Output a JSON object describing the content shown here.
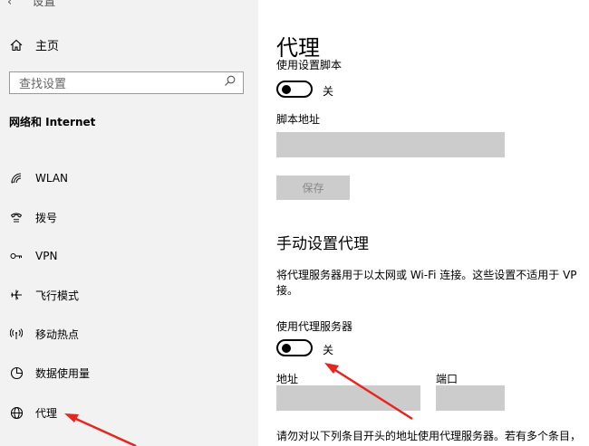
{
  "window": {
    "back_glyph": "‹",
    "title_partial": "设置"
  },
  "sidebar": {
    "home_label": "主页",
    "search_placeholder": "查找设置",
    "section_title": "网络和 Internet",
    "items": [
      {
        "label": "WLAN",
        "icon": "wifi-icon"
      },
      {
        "label": "拨号",
        "icon": "dialup-icon"
      },
      {
        "label": "VPN",
        "icon": "vpn-icon"
      },
      {
        "label": "飞行模式",
        "icon": "airplane-icon"
      },
      {
        "label": "移动热点",
        "icon": "hotspot-icon"
      },
      {
        "label": "数据使用量",
        "icon": "data-usage-icon"
      },
      {
        "label": "代理",
        "icon": "globe-icon"
      }
    ]
  },
  "main": {
    "title": "代理",
    "script_label": "使用设置脚本",
    "script_toggle_state": "关",
    "script_address_label": "脚本地址",
    "save_label": "保存",
    "manual_heading": "手动设置代理",
    "manual_desc_line1": "将代理服务器用于以太网或 Wi-Fi 连接。这些设置不适用于 VP",
    "manual_desc_line2": "接。",
    "use_proxy_label": "使用代理服务器",
    "proxy_toggle_state": "关",
    "address_label": "地址",
    "port_label": "端口",
    "bottom_desc": "请勿对以下列条目开头的地址使用代理服务器。若有多个条目，"
  },
  "colors": {
    "sidebar_bg": "#f2f2f2",
    "field_bg": "#cccccc",
    "arrow": "#e8251c"
  }
}
